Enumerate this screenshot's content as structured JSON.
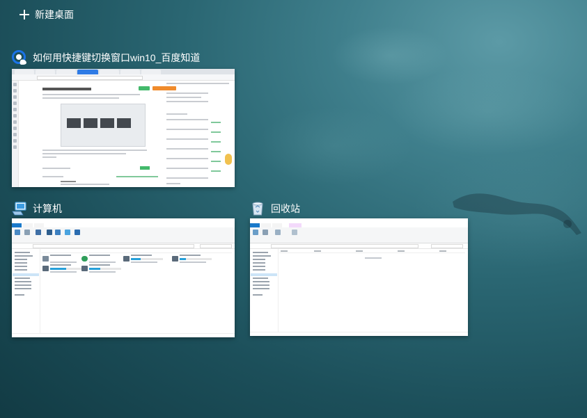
{
  "new_desktop": {
    "label": "新建桌面"
  },
  "windows": [
    {
      "title": "如何用快捷键切换窗口win10_百度知道",
      "icon": "browser-icon"
    },
    {
      "title": "计算机",
      "icon": "computer-icon"
    },
    {
      "title": "回收站",
      "icon": "recycle-bin-icon"
    }
  ],
  "colors": {
    "background_water": "#2a6672",
    "text": "#ffffff",
    "browser_tab_active": "#2f7be5",
    "explorer_file_tab": "#1979ca",
    "drive_bar": "#26a0da"
  }
}
